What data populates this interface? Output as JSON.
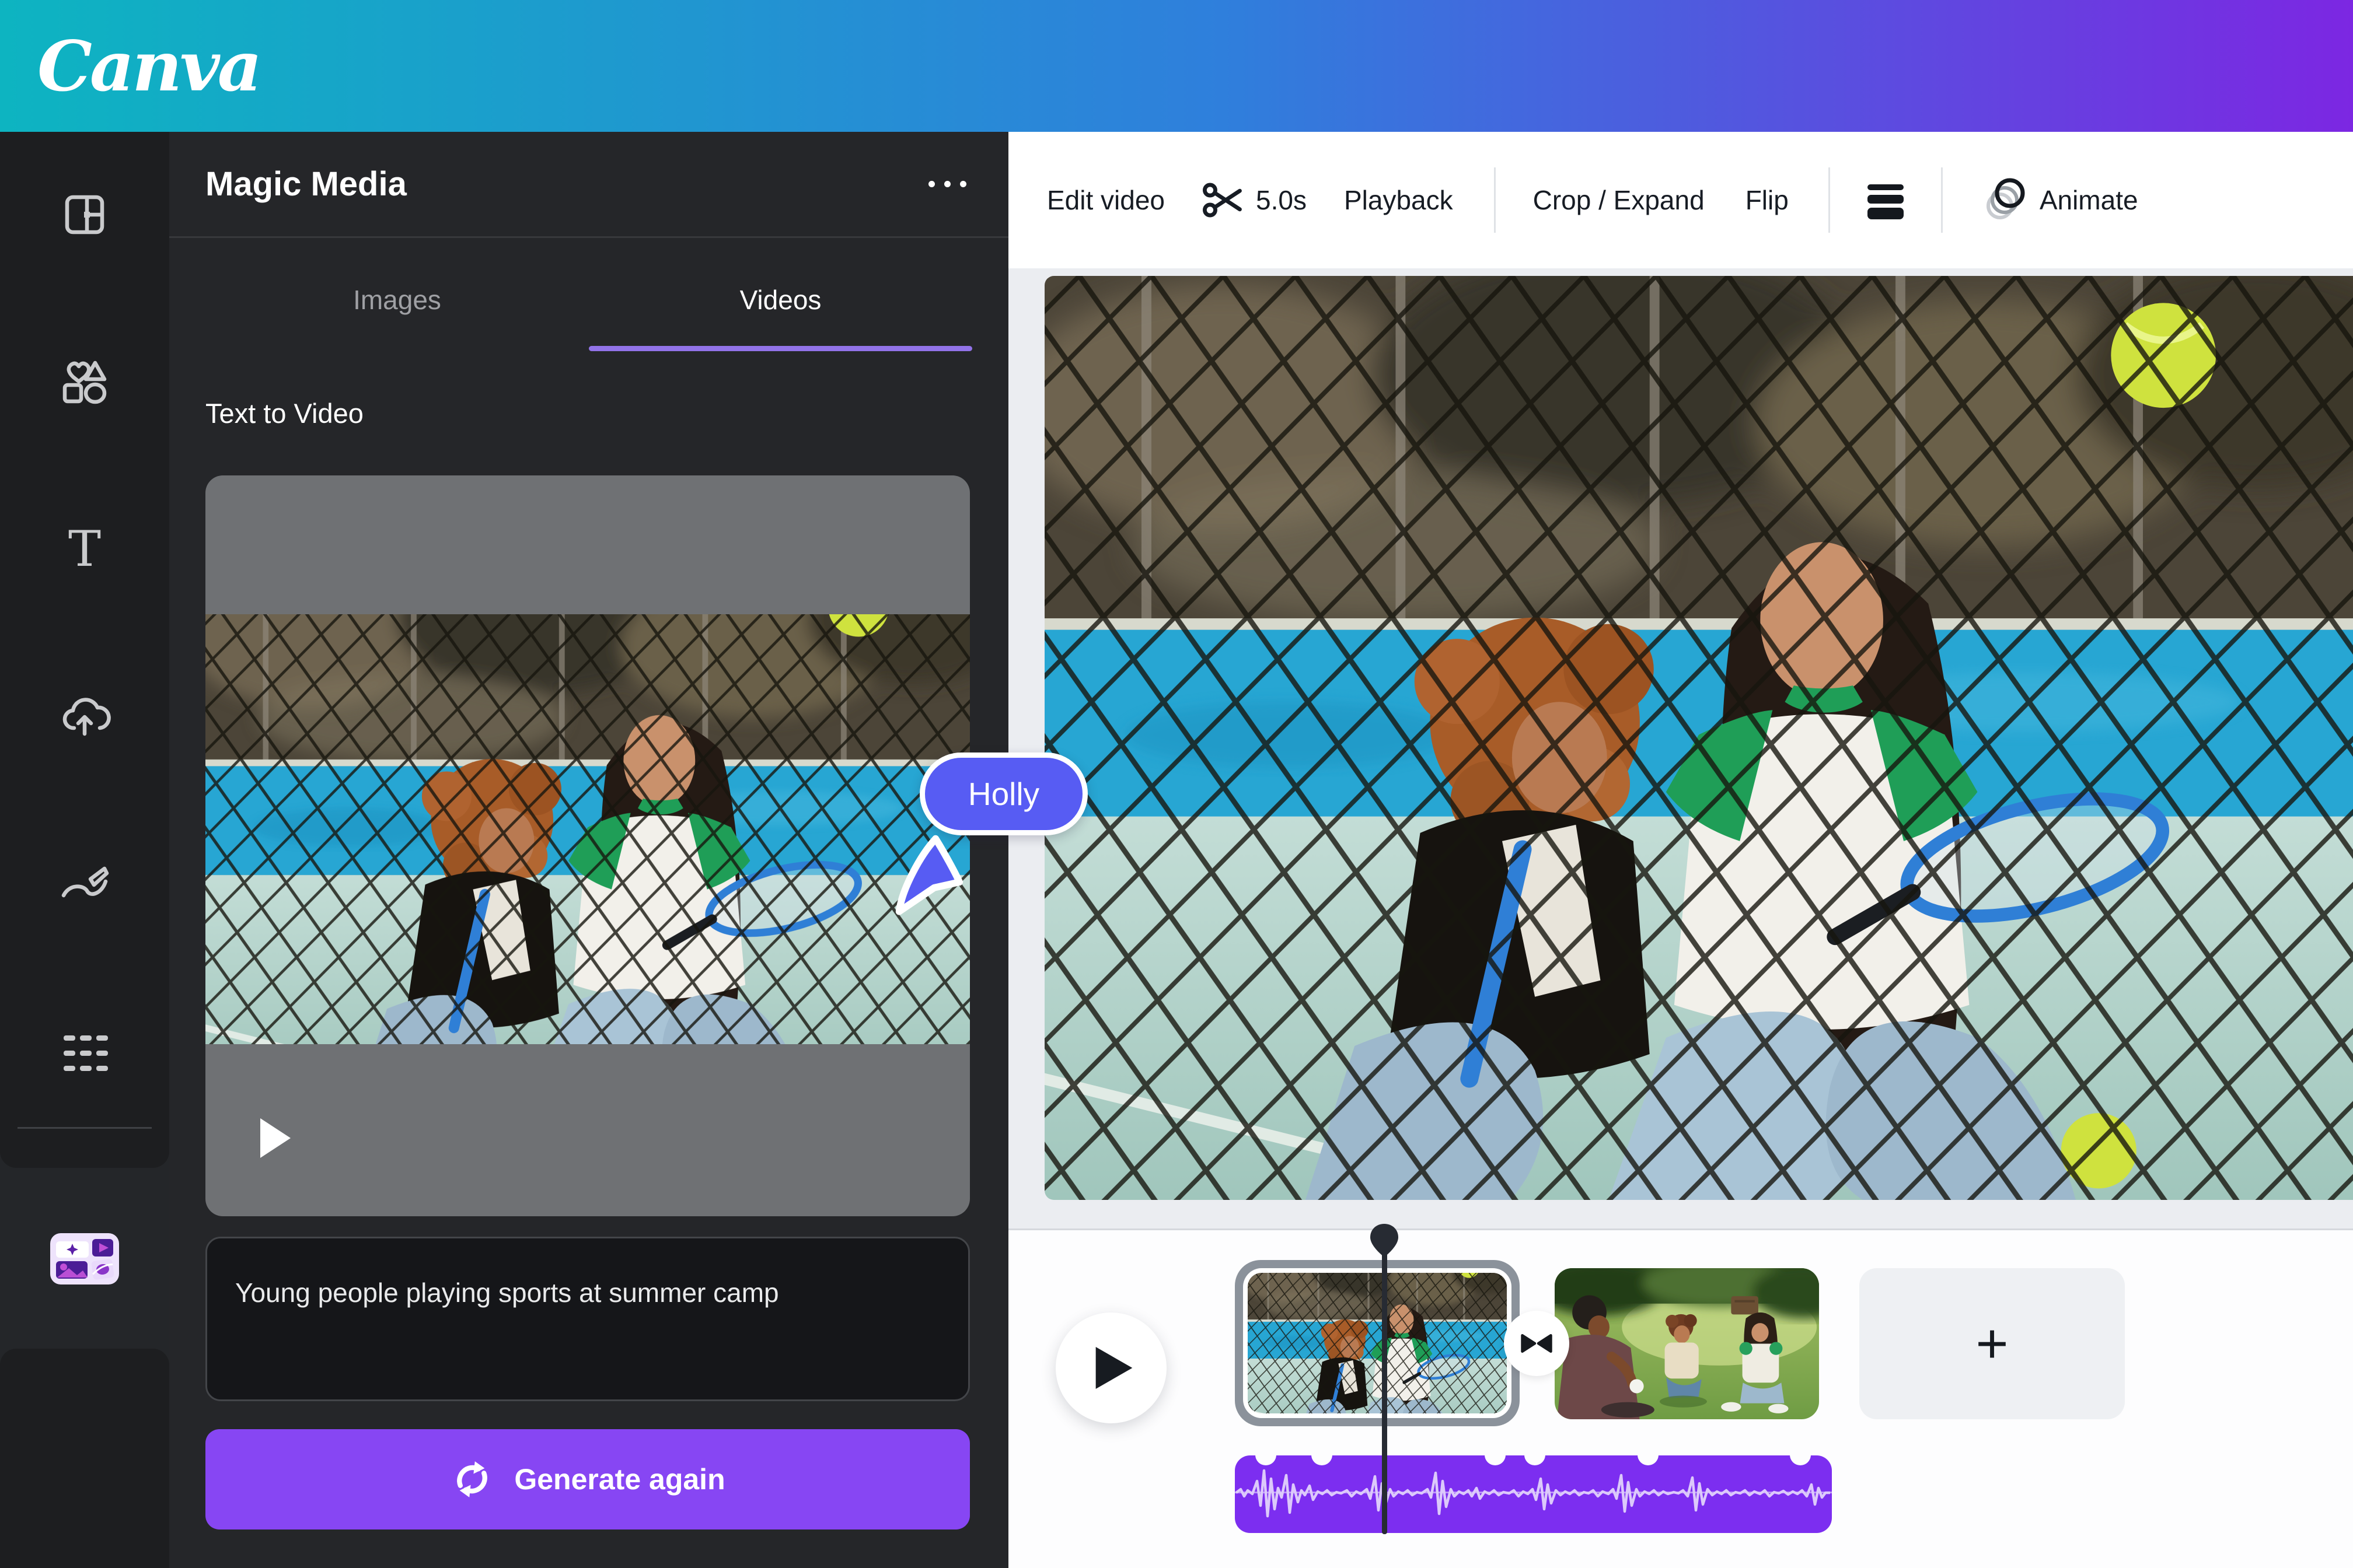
{
  "topbar": {
    "logo": "Canva"
  },
  "panel": {
    "title": "Magic Media",
    "tabs": [
      {
        "label": "Images",
        "active": false
      },
      {
        "label": "Videos",
        "active": true
      }
    ],
    "section_title": "Text to Video",
    "prompt_value": "Young people playing sports at summer camp",
    "generate_label": "Generate again"
  },
  "toolbar": {
    "edit_video": "Edit video",
    "duration": "5.0s",
    "playback": "Playback",
    "crop_expand": "Crop / Expand",
    "flip": "Flip",
    "animate": "Animate"
  },
  "canvas": {
    "cursor_label": "Holly"
  },
  "timeline": {
    "add_label": "+"
  },
  "colors": {
    "brand_gradient_start": "#0db4c1",
    "brand_gradient_mid": "#2f7fdc",
    "brand_gradient_end": "#7c27e2",
    "accent_purple": "#8746f3",
    "tab_underline": "#9273e8",
    "cursor_blue": "#575cf3",
    "waveform_purple": "#7c2ef0",
    "rail_bg": "#1d1e20",
    "panel_bg": "#252629"
  },
  "icons": [
    "design-icon",
    "elements-icon",
    "text-icon",
    "uploads-icon",
    "draw-icon",
    "apps-icon",
    "magic-media-app-icon",
    "more-options-icon",
    "scissors-icon",
    "position-icon",
    "animate-icon",
    "play-icon",
    "transition-icon",
    "add-icon",
    "playhead-pin-icon",
    "regenerate-icon",
    "cursor-pointer-icon"
  ]
}
